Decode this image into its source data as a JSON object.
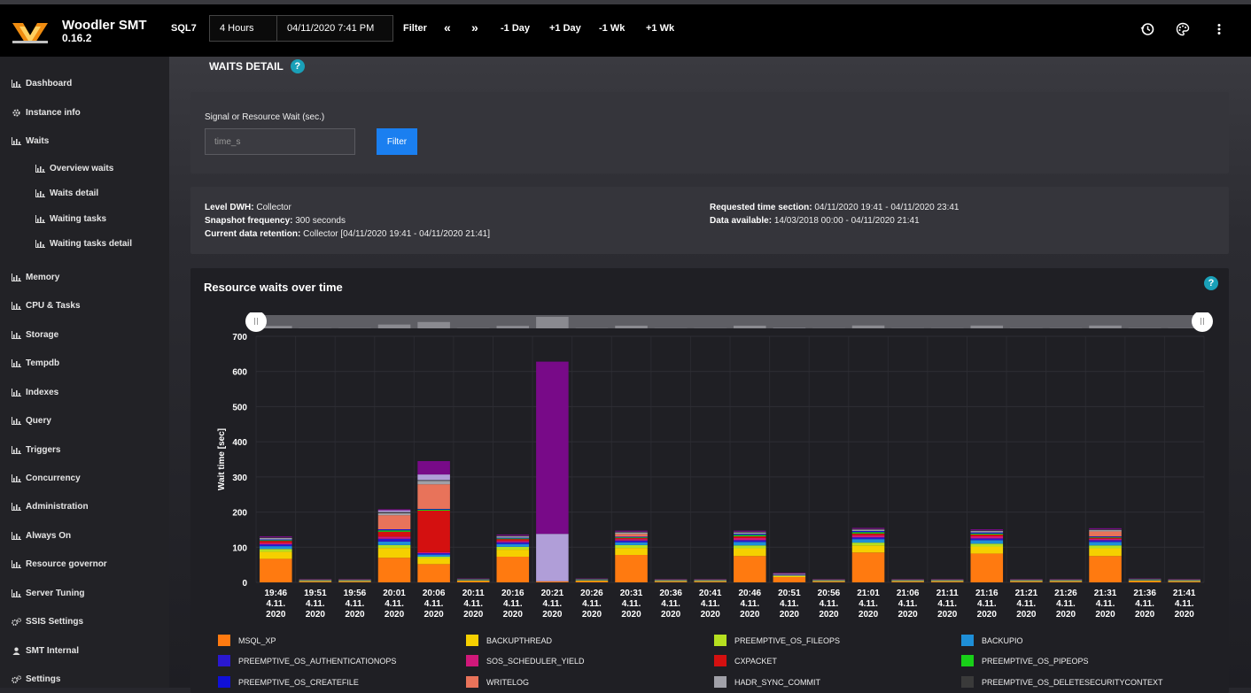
{
  "header": {
    "app_name": "Woodler SMT",
    "version": "0.16.2",
    "instance": "SQL7",
    "range": "4 Hours",
    "datetime": "04/11/2020 7:41 PM",
    "filter_label": "Filter",
    "prev_icon": "«",
    "next_icon": "»",
    "minus_day": "-1 Day",
    "plus_day": "+1 Day",
    "minus_week": "-1 Wk",
    "plus_week": "+1 Wk"
  },
  "sidebar": {
    "items": [
      {
        "label": "Dashboard",
        "icon": "chart-icon"
      },
      {
        "label": "Instance info",
        "icon": "gear-icon"
      },
      {
        "label": "Waits",
        "icon": "chart-icon"
      },
      {
        "label": "Overview waits",
        "icon": "chart-icon"
      },
      {
        "label": "Waits detail",
        "icon": "chart-icon"
      },
      {
        "label": "Waiting tasks",
        "icon": "chart-icon"
      },
      {
        "label": "Waiting tasks detail",
        "icon": "chart-icon"
      },
      {
        "label": "Memory",
        "icon": "chart-icon"
      },
      {
        "label": "CPU & Tasks",
        "icon": "chart-icon"
      },
      {
        "label": "Storage",
        "icon": "chart-icon"
      },
      {
        "label": "Tempdb",
        "icon": "chart-icon"
      },
      {
        "label": "Indexes",
        "icon": "chart-icon"
      },
      {
        "label": "Query",
        "icon": "chart-icon"
      },
      {
        "label": "Triggers",
        "icon": "chart-icon"
      },
      {
        "label": "Concurrency",
        "icon": "chart-icon"
      },
      {
        "label": "Administration",
        "icon": "chart-icon"
      },
      {
        "label": "Always On",
        "icon": "chart-icon"
      },
      {
        "label": "Resource governor",
        "icon": "chart-icon"
      },
      {
        "label": "Server Tuning",
        "icon": "chart-icon"
      },
      {
        "label": "SSIS Settings",
        "icon": "gears-icon"
      },
      {
        "label": "SMT Internal",
        "icon": "user-icon"
      },
      {
        "label": "Settings",
        "icon": "gears-icon"
      }
    ]
  },
  "page": {
    "title": "WAITS DETAIL",
    "help": "?"
  },
  "filter": {
    "label": "Signal or Resource Wait (sec.)",
    "placeholder": "time_s",
    "button": "Filter"
  },
  "info": {
    "level_label": "Level DWH:",
    "level_value": "Collector",
    "snapshot_label": "Snapshot frequency:",
    "snapshot_value": "300 seconds",
    "retention_label": "Current data retention:",
    "retention_value": "Collector [04/11/2020 19:41 - 04/11/2020 21:41]",
    "requested_label": "Requested time section:",
    "requested_value": "04/11/2020 19:41 - 04/11/2020 23:41",
    "available_label": "Data available:",
    "available_value": "14/03/2018 00:00 - 04/11/2020 21:41"
  },
  "chart_data": {
    "type": "bar",
    "title": "Resource waits over time",
    "help": "?",
    "ylabel": "Wait time [sec]",
    "ylim": [
      0,
      700
    ],
    "yticks": [
      "0",
      "100",
      "200",
      "300",
      "400",
      "500",
      "600",
      "700"
    ],
    "categories": [
      [
        "19:46",
        "4.11.",
        "2020"
      ],
      [
        "19:51",
        "4.11.",
        "2020"
      ],
      [
        "19:56",
        "4.11.",
        "2020"
      ],
      [
        "20:01",
        "4.11.",
        "2020"
      ],
      [
        "20:06",
        "4.11.",
        "2020"
      ],
      [
        "20:11",
        "4.11.",
        "2020"
      ],
      [
        "20:16",
        "4.11.",
        "2020"
      ],
      [
        "20:21",
        "4.11.",
        "2020"
      ],
      [
        "20:26",
        "4.11.",
        "2020"
      ],
      [
        "20:31",
        "4.11.",
        "2020"
      ],
      [
        "20:36",
        "4.11.",
        "2020"
      ],
      [
        "20:41",
        "4.11.",
        "2020"
      ],
      [
        "20:46",
        "4.11.",
        "2020"
      ],
      [
        "20:51",
        "4.11.",
        "2020"
      ],
      [
        "20:56",
        "4.11.",
        "2020"
      ],
      [
        "21:01",
        "4.11.",
        "2020"
      ],
      [
        "21:06",
        "4.11.",
        "2020"
      ],
      [
        "21:11",
        "4.11.",
        "2020"
      ],
      [
        "21:16",
        "4.11.",
        "2020"
      ],
      [
        "21:21",
        "4.11.",
        "2020"
      ],
      [
        "21:26",
        "4.11.",
        "2020"
      ],
      [
        "21:31",
        "4.11.",
        "2020"
      ],
      [
        "21:36",
        "4.11.",
        "2020"
      ],
      [
        "21:41",
        "4.11.",
        "2020"
      ]
    ],
    "series": [
      {
        "name": "MSQL_XP",
        "color": "#ff7a10",
        "values": [
          67,
          2,
          2,
          70,
          52,
          3,
          73,
          3,
          3,
          78,
          2,
          2,
          75,
          15,
          2,
          85,
          2,
          2,
          82,
          2,
          2,
          75,
          3,
          2
        ]
      },
      {
        "name": "BACKUPTHREAD",
        "color": "#f5d000",
        "values": [
          20,
          2,
          2,
          28,
          16,
          2,
          20,
          0,
          2,
          20,
          2,
          2,
          22,
          4,
          2,
          20,
          2,
          2,
          20,
          2,
          2,
          22,
          2,
          2
        ]
      },
      {
        "name": "PREEMPTIVE_OS_FILEOPS",
        "color": "#b6e020",
        "values": [
          8,
          0,
          0,
          8,
          5,
          0,
          8,
          0,
          0,
          8,
          0,
          0,
          8,
          0,
          0,
          8,
          0,
          0,
          8,
          0,
          0,
          8,
          0,
          0
        ]
      },
      {
        "name": "BACKUPIO",
        "color": "#1e8fd8",
        "values": [
          8,
          1,
          1,
          10,
          6,
          1,
          8,
          0,
          1,
          8,
          1,
          1,
          10,
          2,
          1,
          10,
          1,
          1,
          10,
          1,
          1,
          10,
          1,
          1
        ]
      },
      {
        "name": "PREEMPTIVE_OS_AUTHENTICATIONOPS",
        "color": "#2a18d0",
        "values": [
          5,
          0,
          0,
          8,
          4,
          0,
          5,
          0,
          0,
          5,
          0,
          0,
          5,
          1,
          0,
          5,
          0,
          0,
          5,
          0,
          0,
          5,
          0,
          0
        ]
      },
      {
        "name": "SOS_SCHEDULER_YIELD",
        "color": "#d0187a",
        "values": [
          4,
          1,
          1,
          6,
          3,
          1,
          4,
          0,
          1,
          4,
          1,
          1,
          6,
          1,
          1,
          6,
          1,
          1,
          6,
          1,
          1,
          4,
          1,
          1
        ]
      },
      {
        "name": "CXPACKET",
        "color": "#d41010",
        "values": [
          6,
          0,
          0,
          14,
          118,
          0,
          5,
          0,
          0,
          3,
          0,
          0,
          5,
          0,
          0,
          5,
          0,
          0,
          5,
          0,
          0,
          3,
          0,
          0
        ]
      },
      {
        "name": "PREEMPTIVE_OS_PIPEOPS",
        "color": "#18d018",
        "values": [
          2,
          1,
          1,
          4,
          3,
          1,
          2,
          0,
          1,
          2,
          1,
          1,
          4,
          0,
          1,
          4,
          1,
          1,
          3,
          1,
          1,
          2,
          1,
          1
        ]
      },
      {
        "name": "PREEMPTIVE_OS_CREATEFILE",
        "color": "#1010d8",
        "values": [
          2,
          0,
          0,
          3,
          2,
          0,
          2,
          0,
          0,
          2,
          0,
          0,
          3,
          0,
          0,
          3,
          0,
          0,
          3,
          0,
          0,
          2,
          0,
          0
        ]
      },
      {
        "name": "WRITELOG",
        "color": "#e8735a",
        "values": [
          0,
          0,
          0,
          40,
          70,
          0,
          0,
          0,
          0,
          8,
          0,
          0,
          0,
          0,
          0,
          0,
          0,
          0,
          0,
          0,
          0,
          14,
          0,
          0
        ]
      },
      {
        "name": "HADR_SYNC_COMMIT",
        "color": "#a0a0a8",
        "values": [
          4,
          1,
          1,
          6,
          10,
          1,
          4,
          0,
          1,
          4,
          1,
          1,
          4,
          2,
          1,
          4,
          1,
          1,
          4,
          1,
          1,
          4,
          1,
          1
        ]
      },
      {
        "name": "PREEMPTIVE_OS_DELETESECURITYCONTEXT",
        "color": "#3a3a3a",
        "values": [
          2,
          1,
          1,
          3,
          2,
          1,
          2,
          0,
          1,
          2,
          1,
          1,
          2,
          0,
          1,
          2,
          1,
          1,
          2,
          1,
          1,
          2,
          1,
          1
        ]
      },
      {
        "name": "",
        "color": "#b09ed8",
        "values": [
          0,
          0,
          0,
          5,
          16,
          0,
          0,
          135,
          0,
          0,
          0,
          0,
          0,
          0,
          0,
          0,
          0,
          0,
          0,
          0,
          0,
          0,
          0,
          0
        ]
      },
      {
        "name": "",
        "color": "#780a88",
        "values": [
          3,
          1,
          1,
          3,
          38,
          1,
          3,
          490,
          1,
          3,
          1,
          1,
          3,
          2,
          1,
          3,
          1,
          1,
          3,
          1,
          1,
          3,
          1,
          1
        ]
      }
    ],
    "grid": true,
    "legend_position": "bottom"
  }
}
